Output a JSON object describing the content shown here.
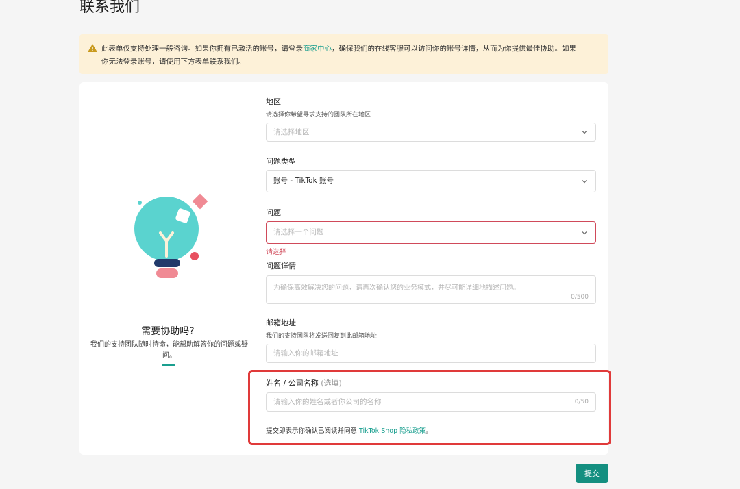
{
  "page": {
    "title": "联系我们"
  },
  "notice": {
    "text_before": "此表单仅支持处理一般咨询。如果你拥有已激活的账号，请登录",
    "link": "商家中心",
    "text_after_line1": "，确保我们的在线客服可以访问你的账号详情，从而为你提供最佳协助。如果",
    "text_line2": "你无法登录账号，请使用下方表单联系我们。"
  },
  "help": {
    "title": "需要协助吗?",
    "description": "我们的支持团队随时待命，能帮助解答你的问题或疑问。"
  },
  "form": {
    "region": {
      "label": "地区",
      "hint": "请选择你希望寻求支持的团队所在地区",
      "placeholder": "请选择地区"
    },
    "issue_type": {
      "label": "问题类型",
      "value": "账号 - TikTok 账号"
    },
    "issue": {
      "label": "问题",
      "placeholder": "请选择一个问题",
      "error": "请选择"
    },
    "details": {
      "label": "问题详情",
      "placeholder": "为确保高效解决您的问题，请再次确认您的业务模式，并尽可能详细地描述问题。",
      "counter": "0/500"
    },
    "email": {
      "label": "邮箱地址",
      "hint": "我们的支持团队将发送回复到此邮箱地址",
      "placeholder": "请输入你的邮箱地址"
    },
    "name": {
      "label": "姓名 / 公司名称",
      "optional": "(选填)",
      "placeholder": "请输入你的姓名或者你公司的名称",
      "counter": "0/50"
    },
    "consent": {
      "text": "提交即表示你确认已阅读并同意 ",
      "link": "TikTok Shop 隐私政策",
      "suffix": "。"
    },
    "submit_label": "提交"
  },
  "colors": {
    "accent": "#1a9f8f",
    "error": "#d04a5a",
    "notice_bg": "#fdf1d8",
    "highlight": "#e03a3a"
  }
}
